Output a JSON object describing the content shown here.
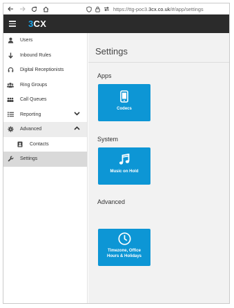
{
  "browser": {
    "back_icon": "arrow-left-icon",
    "forward_icon": "arrow-right-icon",
    "reload_icon": "reload-icon",
    "home_icon": "home-icon",
    "url_prefix": "https://ttg-poc3.",
    "url_host": "3cx.co.uk",
    "url_path": "/#/app/settings"
  },
  "appbar": {
    "menu_icon": "hamburger-menu-icon",
    "logo_prefix": "3",
    "logo_suffix": "CX"
  },
  "sidebar": {
    "items": [
      {
        "label": "Users",
        "icon": "user-icon"
      },
      {
        "label": "Inbound Rules",
        "icon": "arrow-down-icon"
      },
      {
        "label": "Digital Receptionists",
        "icon": "headset-icon"
      },
      {
        "label": "Ring Groups",
        "icon": "users-group-icon"
      },
      {
        "label": "Call Queues",
        "icon": "queue-icon"
      },
      {
        "label": "Reporting",
        "icon": "list-icon",
        "state": "collapsed"
      },
      {
        "label": "Advanced",
        "icon": "gear-icon",
        "state": "expanded"
      },
      {
        "label": "Contacts",
        "icon": "address-book-icon"
      },
      {
        "label": "Settings",
        "icon": "wrench-icon",
        "active": true
      }
    ]
  },
  "main": {
    "title": "Settings",
    "sections": [
      {
        "heading": "Apps",
        "tiles": [
          {
            "label": "Codecs",
            "icon": "mobile-phone-icon"
          }
        ]
      },
      {
        "heading": "System",
        "tiles": [
          {
            "label": "Music on Hold",
            "icon": "music-note-icon"
          }
        ]
      },
      {
        "heading": "Advanced",
        "tiles": [
          {
            "label": "Timezone, Office\nHours & Holidays",
            "icon": "clock-icon"
          }
        ]
      }
    ]
  },
  "colors": {
    "appbar_bg": "#2b2b2b",
    "brand_blue": "#1aa3e8",
    "tile_blue": "#0d96d5",
    "main_bg": "#f2f2f2",
    "sidebar_active": "#d9d9d9"
  }
}
